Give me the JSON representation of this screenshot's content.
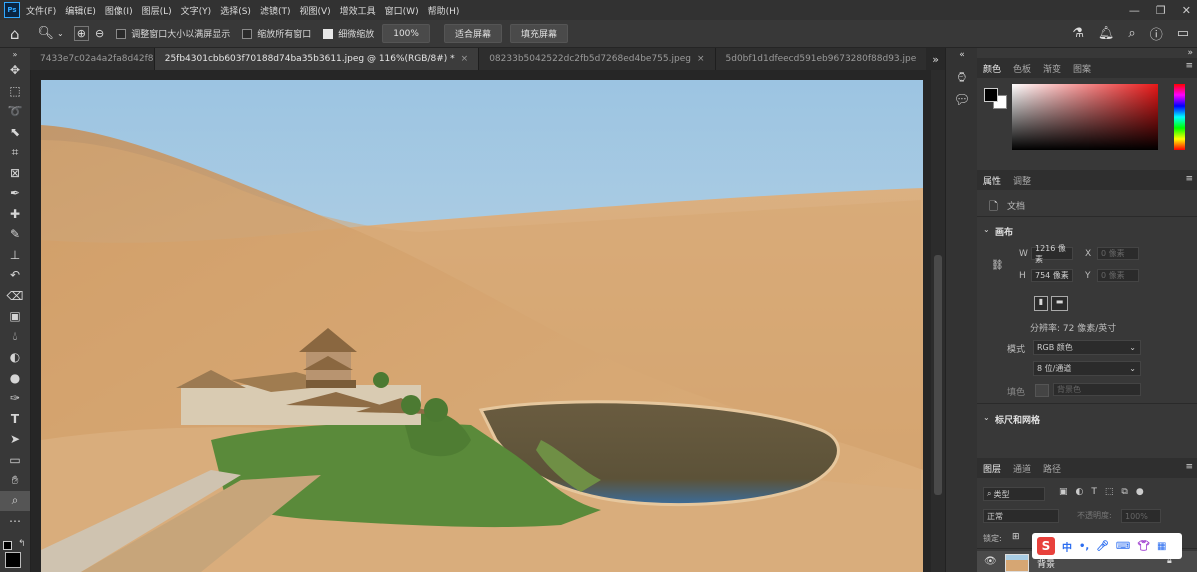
{
  "app": {
    "logo": "Ps"
  },
  "menu": [
    "文件(F)",
    "编辑(E)",
    "图像(I)",
    "图层(L)",
    "文字(Y)",
    "选择(S)",
    "滤镜(T)",
    "视图(V)",
    "增效工具",
    "窗口(W)",
    "帮助(H)"
  ],
  "options": {
    "resize_windows": "调整窗口大小以满屏显示",
    "zoom_all": "缩放所有窗口",
    "scrubby_zoom": "细微缩放",
    "zoom_value": "100%",
    "fit_screen": "适合屏幕",
    "fill_screen": "填充屏幕"
  },
  "tabs": [
    {
      "label": "7433e7c02a4a2fa8d42f88d750662f42.jpeg",
      "active": false
    },
    {
      "label": "25fb4301cbb603f70188d74ba35b3611.jpeg @ 116%(RGB/8#) *",
      "active": true
    },
    {
      "label": "08233b5042522dc2fb5d7268ed4be755.jpeg",
      "active": false
    },
    {
      "label": "5d0bf1d1dfeecd591eb9673280f88d93.jpe",
      "active": false
    }
  ],
  "tab_overflow": "»",
  "panels": {
    "color_tabs": [
      "颜色",
      "色板",
      "渐变",
      "图案"
    ],
    "props_tabs": [
      "属性",
      "调整"
    ],
    "doc_label": "文档",
    "canvas_section": "画布",
    "w_label": "W",
    "w_value": "1216 像素",
    "x_label": "X",
    "x_value": "0 像素",
    "h_label": "H",
    "h_value": "754 像素",
    "y_label": "Y",
    "y_value": "0 像素",
    "resolution": "分辨率: 72 像素/英寸",
    "mode_label": "模式",
    "mode_value": "RGB 颜色",
    "bit_value": "8 位/通道",
    "fill_label": "填色",
    "fill_value": "背景色",
    "rulers_section": "标尺和网格",
    "layers_tabs": [
      "图层",
      "通道",
      "路径"
    ],
    "layer_filter": "类型",
    "blend_mode": "正常",
    "opacity_label": "不透明度:",
    "opacity_value": "100%",
    "lock_label": "锁定:",
    "layer_name": "背景"
  },
  "ime": {
    "logo": "S",
    "lang": "中",
    "items": [
      "•,",
      "mic",
      "kbd",
      "shirt",
      "grid"
    ]
  },
  "colors": {
    "foreground": "#000000",
    "background": "#ffffff",
    "sky": "#a9cde4",
    "sand": "#d6a673",
    "lake": "#6b5e3e",
    "vegetation": "#5a8a3a"
  }
}
